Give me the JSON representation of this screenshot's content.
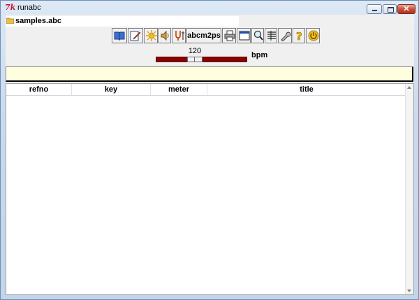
{
  "window": {
    "title": "runabc",
    "app_icon": "tk-feather-icon",
    "controls": [
      "minimize-icon",
      "maximize-icon",
      "close-icon"
    ]
  },
  "file": {
    "name": "samples.abc",
    "icon": "folder-icon"
  },
  "toolbar": {
    "buttons": [
      {
        "icon": "book-icon"
      },
      {
        "icon": "edit-icon"
      },
      {
        "icon": "sun-icon"
      },
      {
        "icon": "speaker-icon"
      },
      {
        "icon": "tuning-fork-icon"
      },
      {
        "label": "abcm2ps"
      },
      {
        "icon": "printer-icon"
      },
      {
        "icon": "window-icon"
      },
      {
        "icon": "magnifier-icon"
      },
      {
        "icon": "list-icon"
      },
      {
        "icon": "wrench-icon"
      },
      {
        "icon": "help-icon"
      },
      {
        "icon": "power-icon"
      }
    ]
  },
  "tempo": {
    "value": "120",
    "unit": "bpm",
    "level": 0.41
  },
  "table": {
    "columns": [
      "refno",
      "key",
      "meter",
      "title"
    ],
    "rows": []
  },
  "colors": {
    "slider_track": "#8b0000",
    "message_bg": "#ffffe0"
  }
}
